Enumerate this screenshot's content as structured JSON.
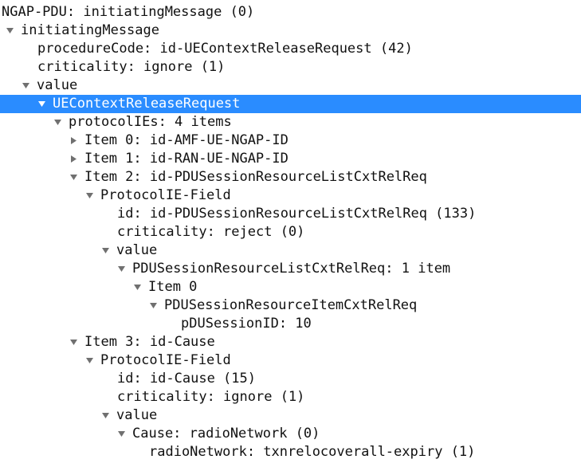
{
  "rows": [
    {
      "indent": 2,
      "toggle": null,
      "text": "NGAP-PDU: initiatingMessage (0)",
      "sel": false,
      "name": "ngap-pdu-row",
      "int": true
    },
    {
      "indent": 7,
      "toggle": "open",
      "text": "initiatingMessage",
      "sel": false,
      "name": "initiating-message-row",
      "int": true
    },
    {
      "indent": 47,
      "toggle": null,
      "text": "procedureCode: id-UEContextReleaseRequest (42)",
      "sel": false,
      "name": "procedure-code-row",
      "int": true
    },
    {
      "indent": 47,
      "toggle": null,
      "text": "criticality: ignore (1)",
      "sel": false,
      "name": "criticality-row",
      "int": true
    },
    {
      "indent": 27,
      "toggle": "open",
      "text": "value",
      "sel": false,
      "name": "value-row",
      "int": true
    },
    {
      "indent": 47,
      "toggle": "open",
      "text": "UEContextReleaseRequest",
      "sel": true,
      "name": "uecontextreleaserequest-row",
      "int": true
    },
    {
      "indent": 67,
      "toggle": "open",
      "text": "protocolIEs: 4 items",
      "sel": false,
      "name": "protocolies-row",
      "int": true
    },
    {
      "indent": 87,
      "toggle": "closed",
      "text": "Item 0: id-AMF-UE-NGAP-ID",
      "sel": false,
      "name": "item-0-row",
      "int": true
    },
    {
      "indent": 87,
      "toggle": "closed",
      "text": "Item 1: id-RAN-UE-NGAP-ID",
      "sel": false,
      "name": "item-1-row",
      "int": true
    },
    {
      "indent": 87,
      "toggle": "open",
      "text": "Item 2: id-PDUSessionResourceListCxtRelReq",
      "sel": false,
      "name": "item-2-row",
      "int": true
    },
    {
      "indent": 107,
      "toggle": "open",
      "text": "ProtocolIE-Field",
      "sel": false,
      "name": "protocolie-field-2-row",
      "int": true
    },
    {
      "indent": 147,
      "toggle": null,
      "text": "id: id-PDUSessionResourceListCxtRelReq (133)",
      "sel": false,
      "name": "ie2-id-row",
      "int": true
    },
    {
      "indent": 147,
      "toggle": null,
      "text": "criticality: reject (0)",
      "sel": false,
      "name": "ie2-criticality-row",
      "int": true
    },
    {
      "indent": 127,
      "toggle": "open",
      "text": "value",
      "sel": false,
      "name": "ie2-value-row",
      "int": true
    },
    {
      "indent": 147,
      "toggle": "open",
      "text": "PDUSessionResourceListCxtRelReq: 1 item",
      "sel": false,
      "name": "pdulist-row",
      "int": true
    },
    {
      "indent": 167,
      "toggle": "open",
      "text": "Item 0",
      "sel": false,
      "name": "pdulist-item0-row",
      "int": true
    },
    {
      "indent": 187,
      "toggle": "open",
      "text": "PDUSessionResourceItemCxtRelReq",
      "sel": false,
      "name": "pduitem-row",
      "int": true
    },
    {
      "indent": 227,
      "toggle": null,
      "text": "pDUSessionID: 10",
      "sel": false,
      "name": "pdusessionid-row",
      "int": true
    },
    {
      "indent": 87,
      "toggle": "open",
      "text": "Item 3: id-Cause",
      "sel": false,
      "name": "item-3-row",
      "int": true
    },
    {
      "indent": 107,
      "toggle": "open",
      "text": "ProtocolIE-Field",
      "sel": false,
      "name": "protocolie-field-3-row",
      "int": true
    },
    {
      "indent": 147,
      "toggle": null,
      "text": "id: id-Cause (15)",
      "sel": false,
      "name": "ie3-id-row",
      "int": true
    },
    {
      "indent": 147,
      "toggle": null,
      "text": "criticality: ignore (1)",
      "sel": false,
      "name": "ie3-criticality-row",
      "int": true
    },
    {
      "indent": 127,
      "toggle": "open",
      "text": "value",
      "sel": false,
      "name": "ie3-value-row",
      "int": true
    },
    {
      "indent": 147,
      "toggle": "open",
      "text": "Cause: radioNetwork (0)",
      "sel": false,
      "name": "cause-row",
      "int": true
    },
    {
      "indent": 187,
      "toggle": null,
      "text": "radioNetwork: txnrelocoverall-expiry (1)",
      "sel": false,
      "name": "radionetwork-row",
      "int": true
    }
  ],
  "icon": {
    "open": "#888",
    "closed": "#888"
  }
}
